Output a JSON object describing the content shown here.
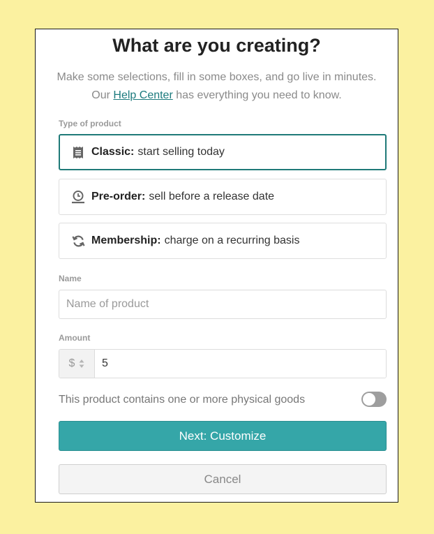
{
  "header": {
    "title": "What are you creating?",
    "subtitle_before": "Make some selections, fill in some boxes, and go live in minutes. Our ",
    "help_link": "Help Center",
    "subtitle_after": " has everything you need to know."
  },
  "product_type": {
    "label": "Type of product",
    "options": [
      {
        "icon": "receipt-icon",
        "name": "Classic:",
        "desc": "start selling today",
        "selected": true
      },
      {
        "icon": "clock-icon",
        "name": "Pre-order:",
        "desc": "sell before a release date",
        "selected": false
      },
      {
        "icon": "refresh-icon",
        "name": "Membership:",
        "desc": "charge on a recurring basis",
        "selected": false
      }
    ]
  },
  "name_field": {
    "label": "Name",
    "placeholder": "Name of product",
    "value": ""
  },
  "amount_field": {
    "label": "Amount",
    "currency": "$",
    "value": "5"
  },
  "physical": {
    "label": "This product contains one or more physical goods",
    "enabled": false
  },
  "buttons": {
    "next": "Next: Customize",
    "cancel": "Cancel"
  },
  "colors": {
    "accent": "#35a6a8",
    "selected_border": "#1f7a78",
    "background": "#fbf1a0",
    "link": "#1c7a7d"
  }
}
